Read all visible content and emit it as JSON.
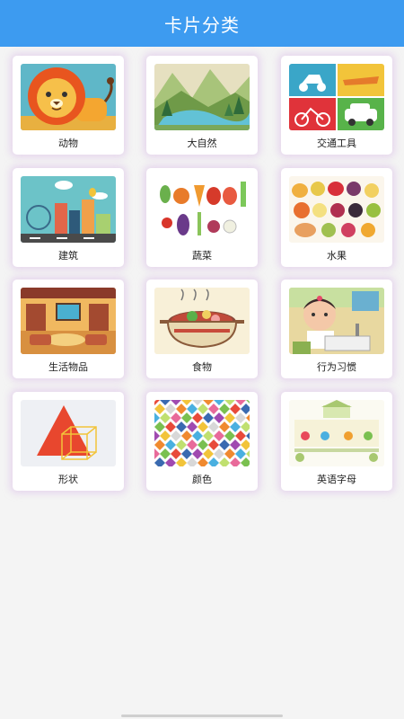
{
  "header": {
    "title": "卡片分类"
  },
  "categories": [
    {
      "label": "动物",
      "icon": "lion-icon"
    },
    {
      "label": "大自然",
      "icon": "nature-landscape-icon"
    },
    {
      "label": "交通工具",
      "icon": "vehicles-icon"
    },
    {
      "label": "建筑",
      "icon": "city-buildings-icon"
    },
    {
      "label": "蔬菜",
      "icon": "vegetables-icon"
    },
    {
      "label": "水果",
      "icon": "fruits-icon"
    },
    {
      "label": "生活物品",
      "icon": "living-room-icon"
    },
    {
      "label": "食物",
      "icon": "hot-pot-icon"
    },
    {
      "label": "行为习惯",
      "icon": "child-washing-icon"
    },
    {
      "label": "形状",
      "icon": "triangle-cube-icon"
    },
    {
      "label": "颜色",
      "icon": "color-diamonds-icon"
    },
    {
      "label": "英语字母",
      "icon": "english-letters-icon"
    }
  ],
  "colors": {
    "header": "#3d9bf0",
    "background": "#f4f4f4",
    "card_glow": "#dabee8"
  }
}
